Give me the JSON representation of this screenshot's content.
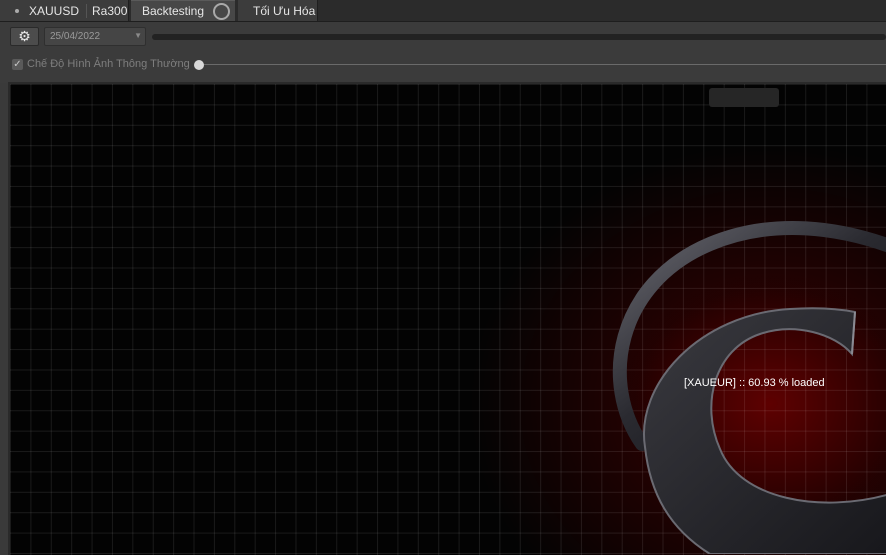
{
  "tabs": {
    "symbol": "XAUUSD",
    "strategy": "Ra300",
    "backtesting": "Backtesting",
    "optimization": "Tối Ưu Hóa"
  },
  "toolbar": {
    "gear_icon": "gear-icon",
    "date_value": "25/04/2022",
    "mode_label": "Chế Độ Hình Ảnh Thông Thường",
    "mode_checked": true,
    "speed_level": 0
  },
  "chart": {
    "loading_text": "[XAUEUR] :: 60.93 % loaded",
    "loaded_percent": 60.93
  },
  "colors": {
    "background": "#3a3a3a",
    "chart_bg": "#030303",
    "glow": "#6e0000"
  }
}
